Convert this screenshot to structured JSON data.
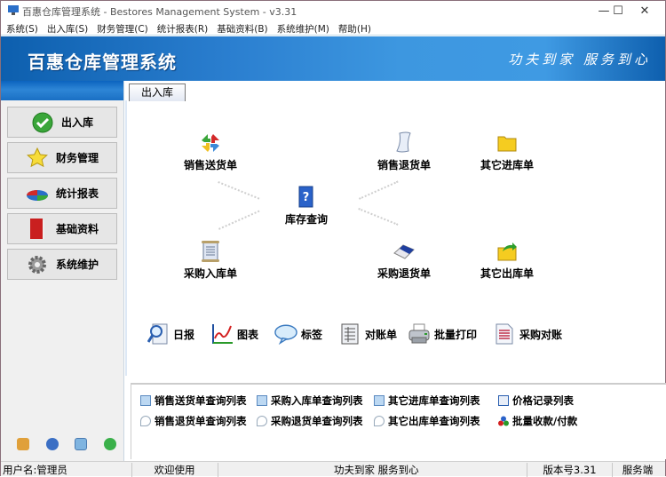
{
  "window": {
    "title": "百惠仓库管理系统 - Bestores Management System - v3.31",
    "controls": {
      "minimize": "—",
      "maximize": "☐",
      "close": "✕"
    }
  },
  "menu": [
    {
      "label": "系统(S)"
    },
    {
      "label": "出入库(S)"
    },
    {
      "label": "财务管理(C)"
    },
    {
      "label": "统计报表(R)"
    },
    {
      "label": "基础资料(B)"
    },
    {
      "label": "系统维护(M)"
    },
    {
      "label": "帮助(H)"
    }
  ],
  "banner": {
    "brand": "百惠仓库管理系统",
    "slogan": "功夫到家 服务到心"
  },
  "sidebar": {
    "items": [
      {
        "label": "出入库",
        "icon": "check-circle-icon"
      },
      {
        "label": "财务管理",
        "icon": "star-icon"
      },
      {
        "label": "统计报表",
        "icon": "pie-chart-icon"
      },
      {
        "label": "基础资料",
        "icon": "book-icon"
      },
      {
        "label": "系统维护",
        "icon": "gear-icon"
      }
    ],
    "bottom_icons": [
      "key-icon",
      "clock-icon",
      "window-search-icon",
      "back-arrow-icon"
    ]
  },
  "tab": {
    "label": "出入库"
  },
  "flow": {
    "sales_delivery": "销售送货单",
    "sales_return": "销售退货单",
    "other_in": "其它进库单",
    "inventory_query": "库存查询",
    "purchase_in": "采购入库单",
    "purchase_return": "采购退货单",
    "other_out": "其它出库单"
  },
  "tools": [
    {
      "label": "日报",
      "icon": "magnifier-report-icon"
    },
    {
      "label": "图表",
      "icon": "line-chart-icon"
    },
    {
      "label": "标签",
      "icon": "speech-bubble-icon"
    },
    {
      "label": "对账单",
      "icon": "ledger-icon"
    },
    {
      "label": "批量打印",
      "icon": "printer-icon"
    },
    {
      "label": "采购对账",
      "icon": "document-list-icon"
    }
  ],
  "links": {
    "row1": [
      {
        "label": "销售送货单查询列表"
      },
      {
        "label": "采购入库单查询列表"
      },
      {
        "label": "其它进库单查询列表"
      },
      {
        "label": "价格记录列表"
      }
    ],
    "row2": [
      {
        "label": "销售退货单查询列表"
      },
      {
        "label": "采购退货单查询列表"
      },
      {
        "label": "其它出库单查询列表"
      },
      {
        "label": "批量收款/付款"
      }
    ]
  },
  "status": {
    "user": "用户名:管理员",
    "welcome": "欢迎使用",
    "slogan": "功夫到家 服务到心",
    "version": "版本号3.31",
    "mode": "服务端"
  }
}
